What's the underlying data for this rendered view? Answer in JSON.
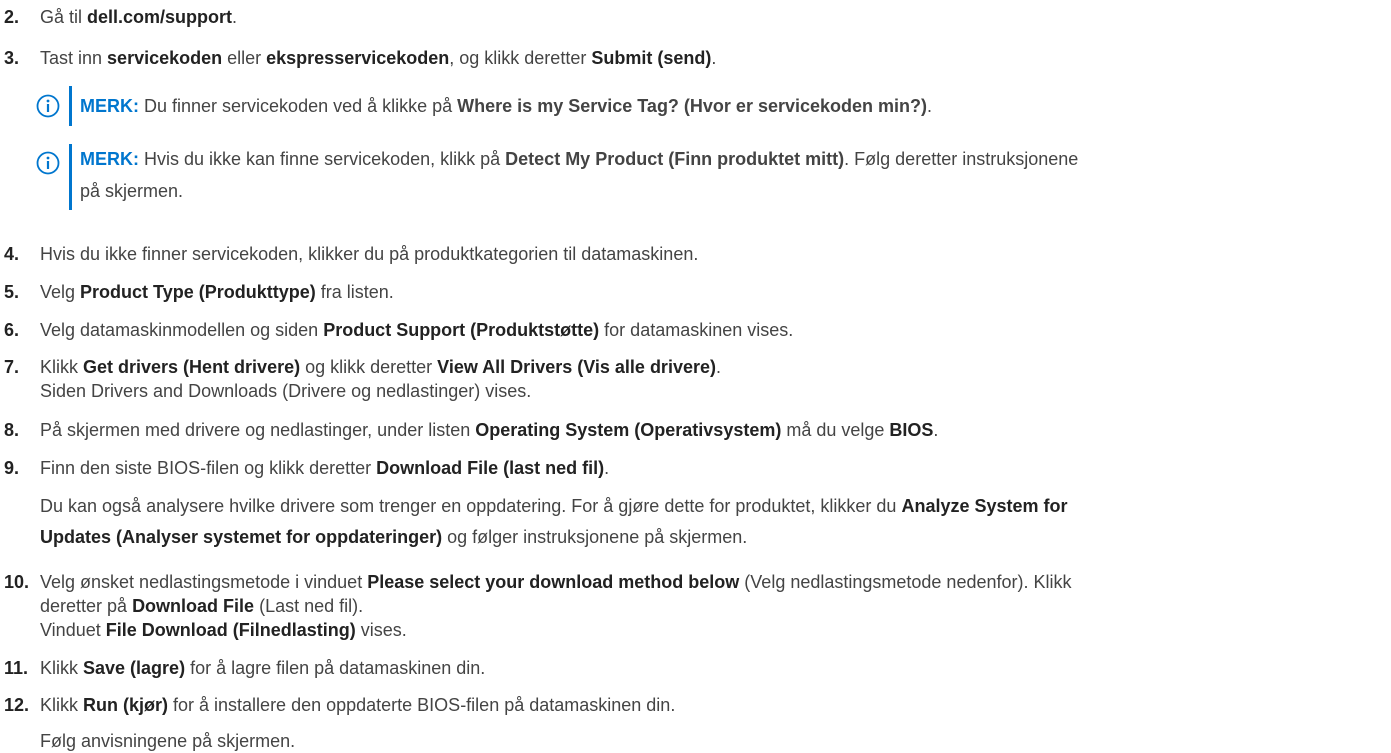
{
  "steps": [
    {
      "num": "2.",
      "parts": [
        {
          "t": "Gå til "
        },
        {
          "t": "dell.com/support",
          "b": true
        },
        {
          "t": "."
        }
      ]
    },
    {
      "num": "3.",
      "parts": [
        {
          "t": "Tast inn "
        },
        {
          "t": "servicekoden",
          "b": true
        },
        {
          "t": " eller "
        },
        {
          "t": "ekspresservicekoden",
          "b": true
        },
        {
          "t": ", og klikk deretter "
        },
        {
          "t": "Submit (send)",
          "b": true
        },
        {
          "t": "."
        }
      ]
    },
    {
      "num": "4.",
      "parts": [
        {
          "t": "Hvis du ikke finner servicekoden, klikker du på produktkategorien til datamaskinen."
        }
      ]
    },
    {
      "num": "5.",
      "parts": [
        {
          "t": "Velg "
        },
        {
          "t": "Product Type (Produkttype)",
          "b": true
        },
        {
          "t": " fra listen."
        }
      ]
    },
    {
      "num": "6.",
      "parts": [
        {
          "t": "Velg datamaskinmodellen og siden "
        },
        {
          "t": "Product Support (Produktstøtte)",
          "b": true
        },
        {
          "t": " for datamaskinen vises."
        }
      ]
    },
    {
      "num": "7.",
      "parts": [
        {
          "t": "Klikk "
        },
        {
          "t": "Get drivers (Hent drivere)",
          "b": true
        },
        {
          "t": " og klikk deretter "
        },
        {
          "t": "View All Drivers (Vis alle drivere)",
          "b": true
        },
        {
          "t": "."
        }
      ],
      "line2": [
        {
          "t": "Siden Drivers and Downloads (Drivere og nedlastinger) vises."
        }
      ]
    },
    {
      "num": "8.",
      "parts": [
        {
          "t": "På skjermen med drivere og nedlastinger, under listen "
        },
        {
          "t": "Operating System (Operativsystem)",
          "b": true
        },
        {
          "t": " må du velge "
        },
        {
          "t": "BIOS",
          "b": true
        },
        {
          "t": "."
        }
      ]
    },
    {
      "num": "9.",
      "parts": [
        {
          "t": "Finn den siste BIOS-filen og klikk deretter "
        },
        {
          "t": "Download File (last ned fil)",
          "b": true
        },
        {
          "t": "."
        }
      ],
      "para_a": [
        {
          "t": "Du kan også analysere hvilke drivere som trenger en oppdatering. For å gjøre dette for produktet, klikker du "
        },
        {
          "t": "Analyze System for",
          "b": true
        }
      ],
      "para_b": [
        {
          "t": "Updates (Analyser systemet for oppdateringer)",
          "b": true
        },
        {
          "t": " og følger instruksjonene på skjermen."
        }
      ]
    },
    {
      "num": "10.",
      "parts": [
        {
          "t": "Velg ønsket nedlastingsmetode i vinduet "
        },
        {
          "t": "Please select your download method below",
          "b": true
        },
        {
          "t": " (Velg nedlastingsmetode nedenfor). Klikk"
        }
      ],
      "line2": [
        {
          "t": "deretter på "
        },
        {
          "t": "Download File",
          "b": true
        },
        {
          "t": " (Last ned fil)."
        }
      ],
      "line3": [
        {
          "t": "Vinduet "
        },
        {
          "t": "File Download (Filnedlasting)",
          "b": true
        },
        {
          "t": " vises."
        }
      ]
    },
    {
      "num": "11.",
      "parts": [
        {
          "t": "Klikk "
        },
        {
          "t": "Save (lagre)",
          "b": true
        },
        {
          "t": " for å lagre filen på datamaskinen din."
        }
      ]
    },
    {
      "num": "12.",
      "parts": [
        {
          "t": "Klikk "
        },
        {
          "t": "Run (kjør)",
          "b": true
        },
        {
          "t": " for å installere den oppdaterte BIOS-filen på datamaskinen din."
        }
      ],
      "para_a": [
        {
          "t": "Følg anvisningene på skjermen."
        }
      ]
    }
  ],
  "notes": [
    {
      "label": "MERK:",
      "parts": [
        {
          "t": " Du finner servicekoden ved å klikke på "
        },
        {
          "t": "Where is my Service Tag? (Hvor er servicekoden min?)",
          "b": true
        },
        {
          "t": "."
        }
      ]
    },
    {
      "label": "MERK:",
      "parts": [
        {
          "t": " Hvis du ikke kan finne servicekoden, klikk på "
        },
        {
          "t": "Detect My Product (Finn produktet mitt)",
          "b": true
        },
        {
          "t": ". Følg deretter instruksjonene"
        }
      ],
      "line2": [
        {
          "t": "på skjermen."
        }
      ]
    }
  ],
  "colors": {
    "accent": "#0076ce",
    "text": "#444444",
    "strong": "#222222"
  },
  "icons": {
    "note": "info-circle-icon"
  }
}
